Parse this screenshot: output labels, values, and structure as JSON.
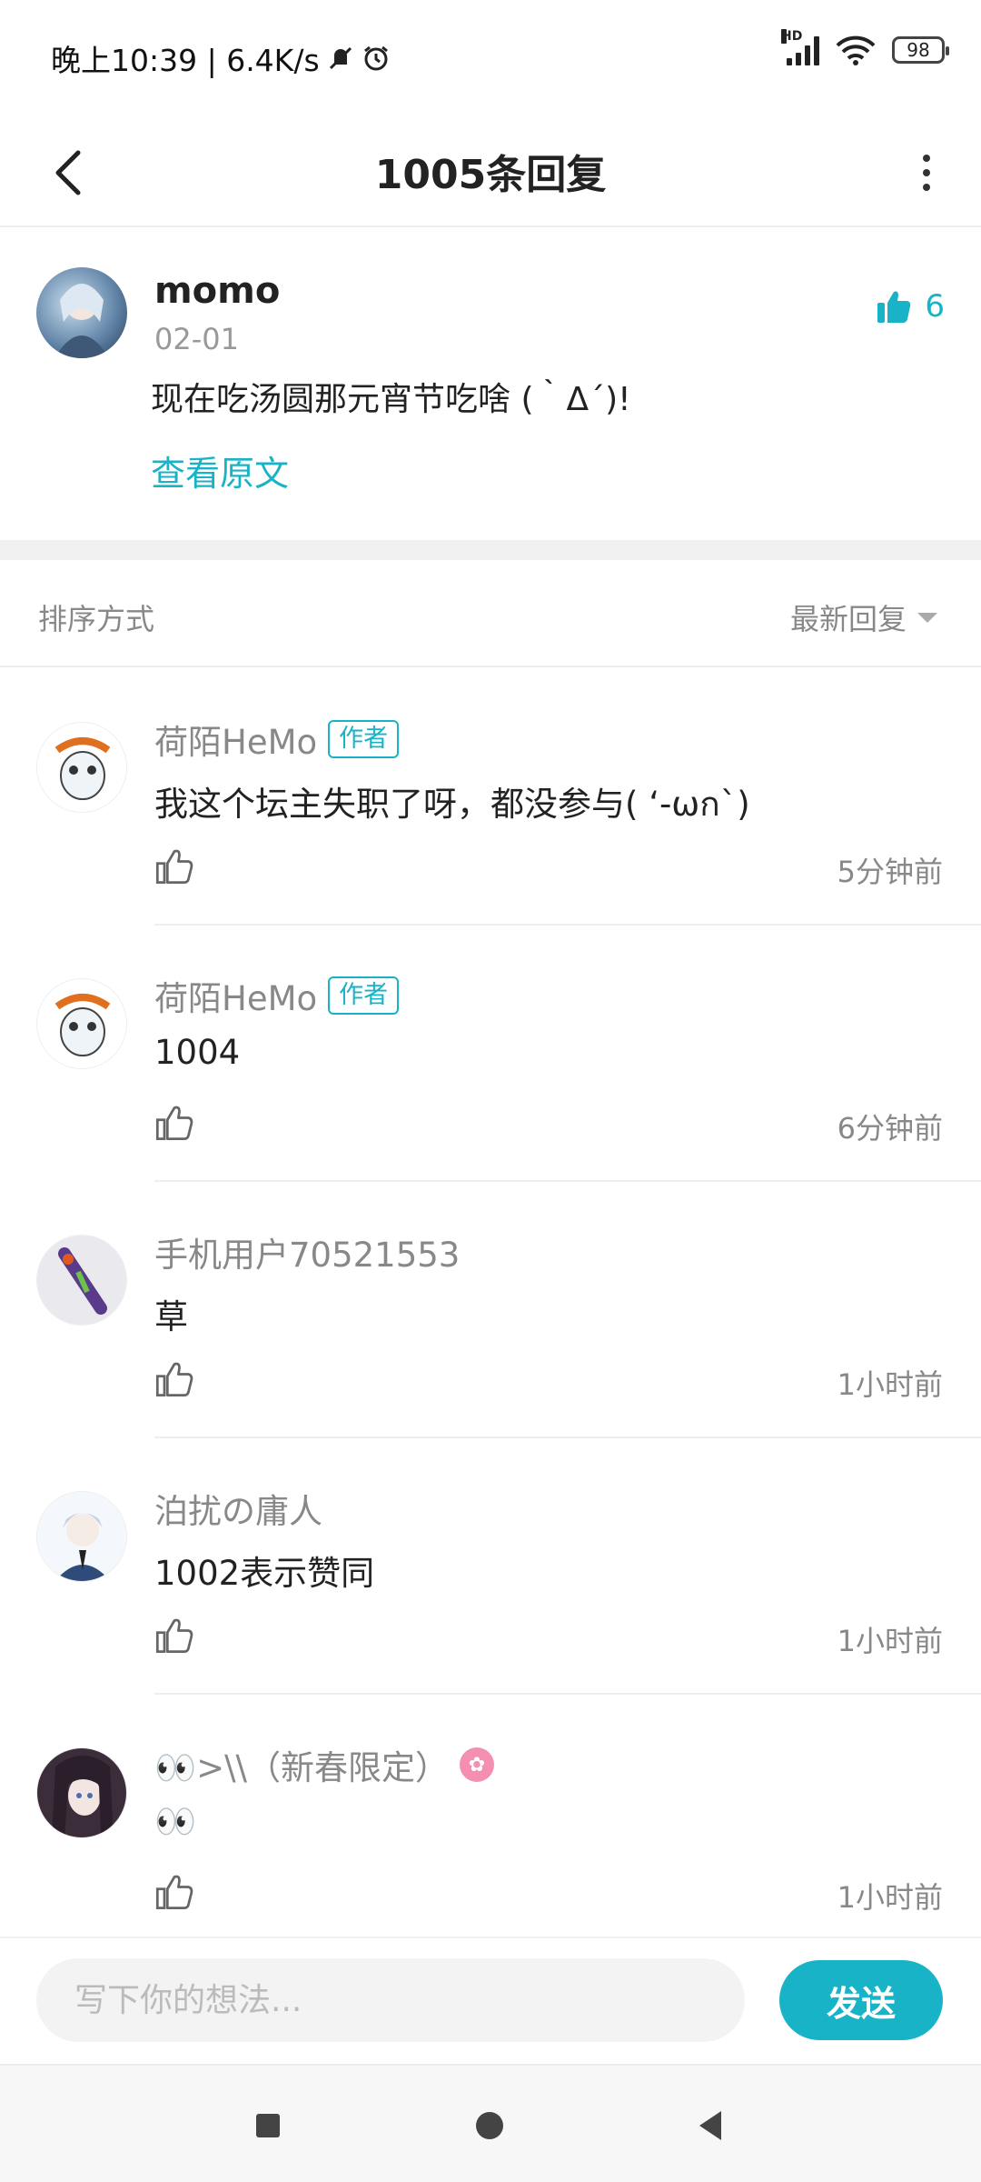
{
  "status_bar": {
    "time_speed": "晚上10:39 | 6.4K/s",
    "battery": "98",
    "network": "HD"
  },
  "header": {
    "title": "1005条回复"
  },
  "post": {
    "author": "momo",
    "date": "02-01",
    "likes": "6",
    "content": "现在吃汤圆那元宵节吃啥 (｀Δ´)!",
    "view_original": "查看原文"
  },
  "sort": {
    "label": "排序方式",
    "value": "最新回复"
  },
  "replies": [
    {
      "author": "荷陌HeMo",
      "badge": "作者",
      "content": "我这个坛主失职了呀，都没参与( ‘-ωก`)",
      "time": "5分钟前"
    },
    {
      "author": "荷陌HeMo",
      "badge": "作者",
      "content": "1004",
      "time": "6分钟前"
    },
    {
      "author": "手机用户70521553",
      "content": "草",
      "time": "1小时前"
    },
    {
      "author": "泊扰の庸人",
      "content": "1002表示赞同",
      "time": "1小时前"
    },
    {
      "author": "👀>\\\\（新春限定）",
      "content": "👀",
      "time": "1小时前"
    }
  ],
  "input_bar": {
    "placeholder": "写下你的想法...",
    "send_label": "发送"
  },
  "colors": {
    "accent": "#19b3c7"
  }
}
